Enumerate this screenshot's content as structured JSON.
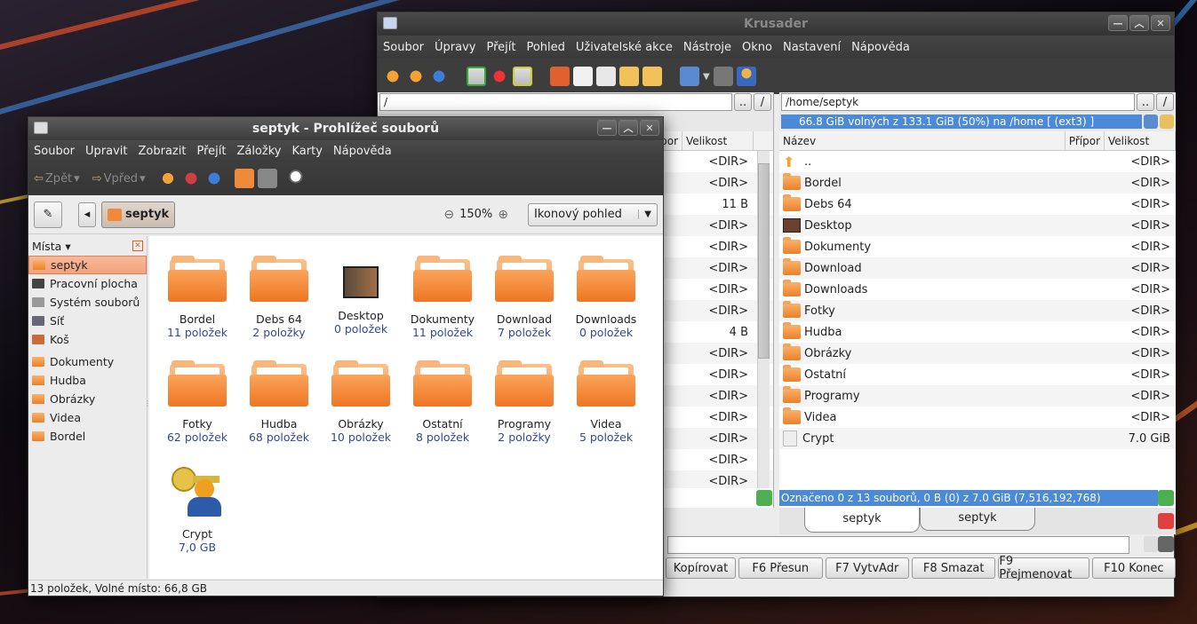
{
  "krusader": {
    "title": "Krusader",
    "menu": [
      "Soubor",
      "Úpravy",
      "Přejít",
      "Pohled",
      "Uživatelské akce",
      "Nástroje",
      "Okno",
      "Nastavení",
      "Nápověda"
    ],
    "left_path": "/",
    "right_path": "/home/septyk",
    "parent_btn": "..",
    "root_btn": "/",
    "free_space": "66.8 GiB volných z 133.1 GiB (50%) na /home [ (ext3) ]",
    "left_headers": {
      "ext": "Přípor",
      "size": "Velikost"
    },
    "right_headers": {
      "name": "Název",
      "ext": "Přípor",
      "size": "Velikost"
    },
    "left_sizes": [
      "<DIR>",
      "<DIR>",
      "11 B",
      "<DIR>",
      "<DIR>",
      "<DIR>",
      "<DIR>",
      "<DIR>",
      "4 B",
      "<DIR>",
      "<DIR>",
      "<DIR>",
      "<DIR>",
      "<DIR>",
      "<DIR>",
      "<DIR>"
    ],
    "right_rows": [
      {
        "name": "..",
        "size": "<DIR>"
      },
      {
        "name": "Bordel",
        "size": "<DIR>"
      },
      {
        "name": "Debs 64",
        "size": "<DIR>"
      },
      {
        "name": "Desktop",
        "size": "<DIR>"
      },
      {
        "name": "Dokumenty",
        "size": "<DIR>"
      },
      {
        "name": "Download",
        "size": "<DIR>"
      },
      {
        "name": "Downloads",
        "size": "<DIR>"
      },
      {
        "name": "Fotky",
        "size": "<DIR>"
      },
      {
        "name": "Hudba",
        "size": "<DIR>"
      },
      {
        "name": "Obrázky",
        "size": "<DIR>"
      },
      {
        "name": "Ostatní",
        "size": "<DIR>"
      },
      {
        "name": "Programy",
        "size": "<DIR>"
      },
      {
        "name": "Videa",
        "size": "<DIR>"
      },
      {
        "name": "Crypt",
        "size": "7.0 GiB"
      }
    ],
    "right_status": "Označeno 0 z 13 souborů, 0 B  (0) z 7.0 GiB (7,516,192,768)",
    "tabs": [
      "septyk",
      "septyk"
    ],
    "fkeys": [
      "Kopírovat",
      "F6 Přesun",
      "F7 VytvAdr",
      "F8 Smazat",
      "F9 Přejmenovat",
      "F10 Konec"
    ]
  },
  "nautilus": {
    "title": "septyk - Prohlížeč souborů",
    "menu": [
      "Soubor",
      "Upravit",
      "Zobrazit",
      "Přejít",
      "Záložky",
      "Karty",
      "Nápověda"
    ],
    "back_label": "Zpět",
    "forward_label": "Vpřed",
    "location": "septyk",
    "zoom": "150%",
    "view_mode": "Ikonový pohled",
    "places_label": "Místa",
    "places": [
      "septyk",
      "Pracovní plocha",
      "Systém souborů",
      "Síť",
      "Koš"
    ],
    "bookmarks": [
      "Dokumenty",
      "Hudba",
      "Obrázky",
      "Videa",
      "Bordel"
    ],
    "items": [
      {
        "name": "Bordel",
        "count": "11 položek"
      },
      {
        "name": "Debs 64",
        "count": "2 položky"
      },
      {
        "name": "Desktop",
        "count": "0 položek"
      },
      {
        "name": "Dokumenty",
        "count": "11 položek"
      },
      {
        "name": "Download",
        "count": "7 položek"
      },
      {
        "name": "Downloads",
        "count": "0 položek"
      },
      {
        "name": "Fotky",
        "count": "62 položek"
      },
      {
        "name": "Hudba",
        "count": "68 položek"
      },
      {
        "name": "Obrázky",
        "count": "10 položek"
      },
      {
        "name": "Ostatní",
        "count": "8 položek"
      },
      {
        "name": "Programy",
        "count": "2 položky"
      },
      {
        "name": "Videa",
        "count": "5 položek"
      },
      {
        "name": "Crypt",
        "count": "7,0 GB"
      }
    ],
    "status": "13 položek, Volné místo: 66,8 GB"
  }
}
